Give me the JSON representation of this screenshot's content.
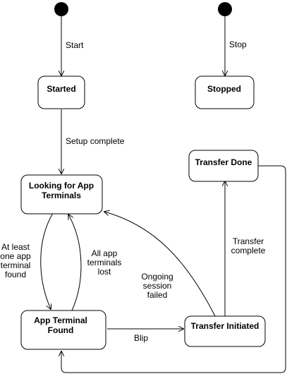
{
  "states": {
    "started": "Started",
    "stopped": "Stopped",
    "looking": [
      "Looking for App",
      "Terminals"
    ],
    "app_terminal_found": [
      "App Terminal",
      "Found"
    ],
    "transfer_initiated": "Transfer Initiated",
    "transfer_done": "Transfer Done"
  },
  "transitions": {
    "start": "Start",
    "stop": "Stop",
    "setup_complete": "Setup complete",
    "at_least_one_found": [
      "At least",
      "one app",
      "terminal",
      "found"
    ],
    "all_lost": [
      "All app",
      "terminals",
      "lost"
    ],
    "ongoing_failed": [
      "Ongoing",
      "session",
      "failed"
    ],
    "blip": "Blip",
    "transfer_complete": [
      "Transfer",
      "complete"
    ]
  }
}
